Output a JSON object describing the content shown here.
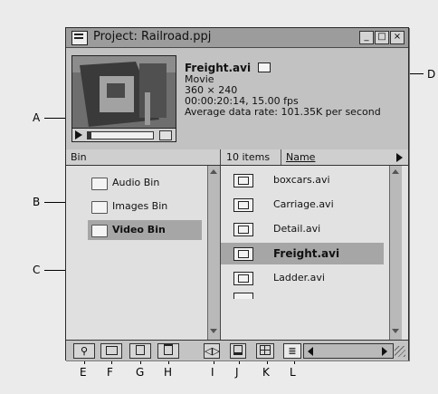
{
  "window": {
    "title": "Project: Railroad.ppj",
    "buttons": {
      "minimize": "_",
      "maximize": "□",
      "close": "×"
    }
  },
  "preview": {
    "file_name": "Freight.avi",
    "kind": "Movie",
    "dimensions": "360 × 240",
    "duration": "00:00:20:14, 15.00 fps",
    "data_rate": "Average data rate: 101.35K per second"
  },
  "bin_pane": {
    "header": "Bin",
    "items": [
      {
        "label": "Audio Bin"
      },
      {
        "label": "Images Bin"
      },
      {
        "label": "Video Bin",
        "selected": true
      }
    ]
  },
  "file_pane": {
    "count": "10 items",
    "column": "Name",
    "items": [
      {
        "label": "boxcars.avi"
      },
      {
        "label": "Carriage.avi"
      },
      {
        "label": "Detail.avi"
      },
      {
        "label": "Freight.avi",
        "selected": true
      },
      {
        "label": "Ladder.avi"
      }
    ]
  },
  "callouts": {
    "A": "A",
    "B": "B",
    "C": "C",
    "D": "D",
    "E": "E",
    "F": "F",
    "G": "G",
    "H": "H",
    "I": "I",
    "J": "J",
    "K": "K",
    "L": "L"
  },
  "colors": {
    "selection": "#a6a6a6",
    "window_bg": "#c9c9c9"
  }
}
